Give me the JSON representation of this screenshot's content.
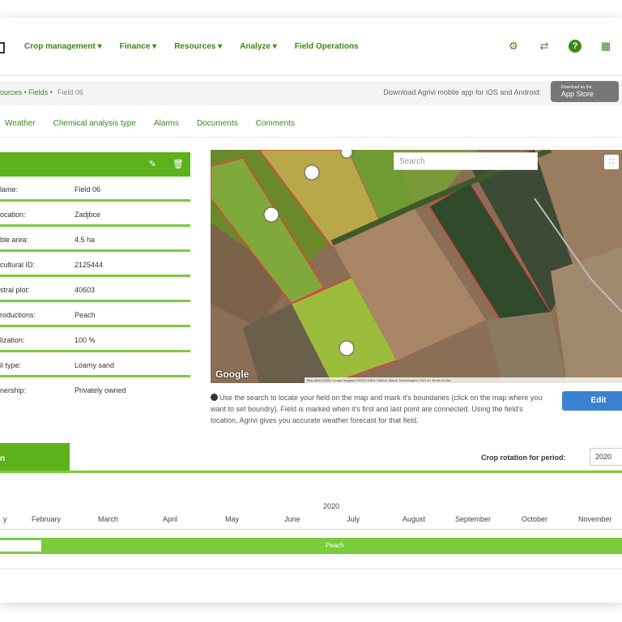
{
  "nav": {
    "menu": [
      "Crop management ▾",
      "Finance ▾",
      "Resources ▾",
      "Analyze ▾",
      "Field Operations"
    ],
    "icons": [
      "gear-icon",
      "transfer-icon",
      "help-icon",
      "calendar-icon"
    ]
  },
  "breadcrumb": {
    "path": "ources • Fields •",
    "current": "Field 06"
  },
  "app_note": "Download Agrivi mobile app for iOS and Android:",
  "appstore": {
    "small": "Download on the",
    "label": "App Store"
  },
  "tabs": [
    "Weather",
    "Chemical analysis type",
    "Alarms",
    "Documents",
    "Comments"
  ],
  "field": {
    "rows": [
      {
        "k": "lame:",
        "v": "Field 06"
      },
      {
        "k": "ocation:",
        "v": "Zadjbce"
      },
      {
        "k": "ble area:",
        "v": "4.5 ha"
      },
      {
        "k": "cultural ID:",
        "v": "2125444"
      },
      {
        "k": "stral plot:",
        "v": "40603"
      },
      {
        "k": "roductions:",
        "v": "Peach"
      },
      {
        "k": "lization:",
        "v": "100 %"
      },
      {
        "k": "il type:",
        "v": "Loamy sand"
      },
      {
        "k": "nership:",
        "v": "Privately owned"
      }
    ]
  },
  "map": {
    "search_placeholder": "Search",
    "google": "Google",
    "attribution": "Map data ©2020 Google Imagery ©2020 CNES / Airbus, Maxar Technologies | 100 m | Terms of Use"
  },
  "help_text": "Use the search to locate your field on the map and mark it's boundaries (click on the map where you want to set boundry). Field is marked when it's first and last point are connected. Using the field's location, Agrivi gives you accurate weather forecast for that field.",
  "edit_label": "Edit",
  "crop": {
    "tab_label": "n",
    "rotation_label": "Crop rotation for period:",
    "rotation_value": "2020",
    "year": "2020",
    "months": [
      "y",
      "February",
      "March",
      "April",
      "May",
      "June",
      "July",
      "August",
      "September",
      "October",
      "November"
    ],
    "bar_label": "Peach"
  },
  "colors": {
    "brand_green": "#5cb21c",
    "accent_blue": "#3a82d0"
  }
}
